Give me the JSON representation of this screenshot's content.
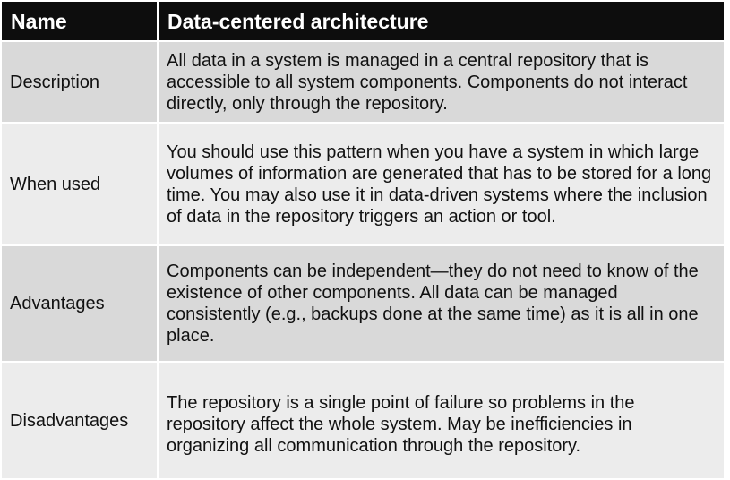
{
  "table": {
    "header": {
      "name": "Name",
      "value": "Data-centered architecture"
    },
    "rows": [
      {
        "label": "Description",
        "text": "All data in a system is managed in a central repository that is accessible to all system components. Components do not interact directly, only through the repository."
      },
      {
        "label": "When used",
        "text": "You should use this pattern when you have a system in which large volumes of information are generated that has to be stored for a long time. You may also use it in data-driven systems where the inclusion of data in the repository triggers an action or tool."
      },
      {
        "label": "Advantages",
        "text": "Components can be independent—they do not need to know of the existence of other components. All data can be managed consistently (e.g., backups done at the same time) as it is all in one place."
      },
      {
        "label": "Disadvantages",
        "text": "The repository is a single point of failure so problems in the repository affect the whole system. May be inefficiencies in organizing all communication through the repository."
      }
    ]
  },
  "colors": {
    "header_bg": "#0d0d0d",
    "row_dark": "#d9d9d9",
    "row_light": "#ececec"
  }
}
